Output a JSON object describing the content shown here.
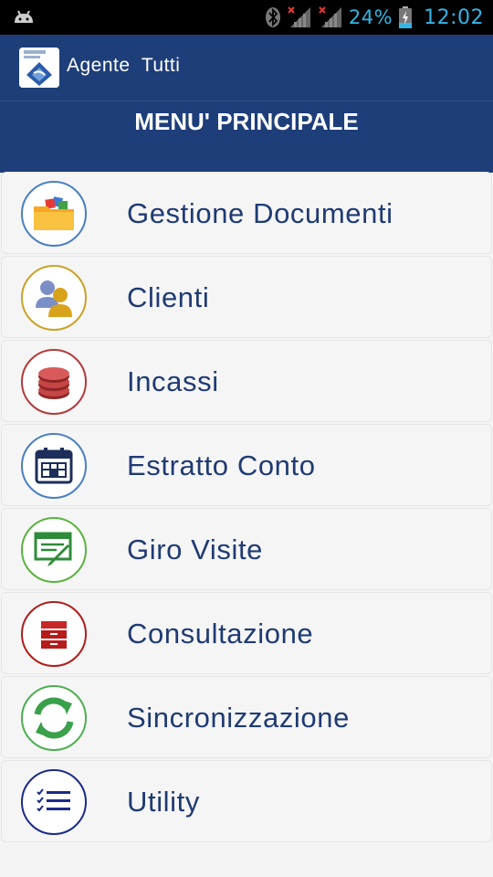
{
  "status_bar": {
    "battery_percent": "24%",
    "time": "12:02",
    "icons": [
      "android-icon",
      "bluetooth-icon",
      "signal-icon-1",
      "signal-icon-2",
      "battery-charging-icon"
    ]
  },
  "app_bar": {
    "logo_icon": "partner-mobile-logo-icon",
    "title": "Agente  Tutti"
  },
  "header": {
    "title": "MENU' PRINCIPALE"
  },
  "menu": {
    "items": [
      {
        "label": "Gestione Documenti",
        "icon": "folder-icon",
        "color": "#4a7fc1"
      },
      {
        "label": "Clienti",
        "icon": "users-icon",
        "color": "#c9a227"
      },
      {
        "label": "Incassi",
        "icon": "coins-icon",
        "color": "#b03a3a"
      },
      {
        "label": "Estratto Conto",
        "icon": "calendar-icon",
        "color": "#4a7fc1"
      },
      {
        "label": "Giro Visite",
        "icon": "visit-form-icon",
        "color": "#5ab33d"
      },
      {
        "label": "Consultazione",
        "icon": "archive-icon",
        "color": "#b01c1c"
      },
      {
        "label": "Sincronizzazione",
        "icon": "sync-icon",
        "color": "#4caf50"
      },
      {
        "label": "Utility",
        "icon": "checklist-icon",
        "color": "#1a2a8a"
      }
    ]
  },
  "colors": {
    "app_bar": "#1e3e7a",
    "status_text": "#33b5e5",
    "label_text": "#1f3b73"
  }
}
